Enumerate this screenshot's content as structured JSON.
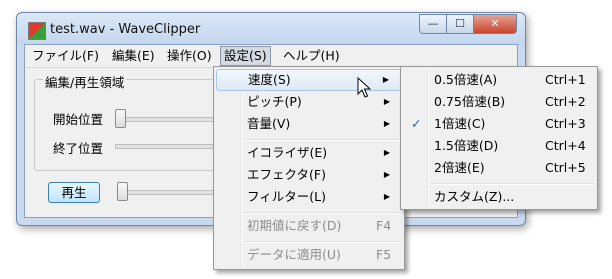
{
  "window": {
    "title": "test.wav - WaveClipper",
    "minimize": "—",
    "maximize": "☐",
    "close": "✕"
  },
  "menubar": [
    "ファイル(F)",
    "編集(E)",
    "操作(O)",
    "設定(S)",
    "ヘルプ(H)"
  ],
  "panel": {
    "group_title": "編集/再生領域",
    "start_label": "開始位置",
    "end_label": "終了位置",
    "play_label": "再生"
  },
  "settings_menu": {
    "items": [
      {
        "label": "速度(S)"
      },
      {
        "label": "ピッチ(P)"
      },
      {
        "label": "音量(V)"
      },
      {
        "label": "イコライザ(E)"
      },
      {
        "label": "エフェクタ(F)"
      },
      {
        "label": "フィルター(L)"
      },
      {
        "label": "初期値に戻す(D)",
        "shortcut": "F4"
      },
      {
        "label": "データに適用(U)",
        "shortcut": "F5"
      }
    ]
  },
  "speed_menu": {
    "items": [
      {
        "label": "0.5倍速(A)",
        "shortcut": "Ctrl+1"
      },
      {
        "label": "0.75倍速(B)",
        "shortcut": "Ctrl+2"
      },
      {
        "label": "1倍速(C)",
        "shortcut": "Ctrl+3"
      },
      {
        "label": "1.5倍速(D)",
        "shortcut": "Ctrl+4"
      },
      {
        "label": "2倍速(E)",
        "shortcut": "Ctrl+5"
      },
      {
        "label": "カスタム(Z)..."
      }
    ],
    "checked_index": 2
  },
  "glyphs": {
    "submenu_arrow": "▶",
    "check": "✓"
  },
  "colors": {
    "highlight_border": "#a8c8eb",
    "check": "#2d5ea8"
  }
}
